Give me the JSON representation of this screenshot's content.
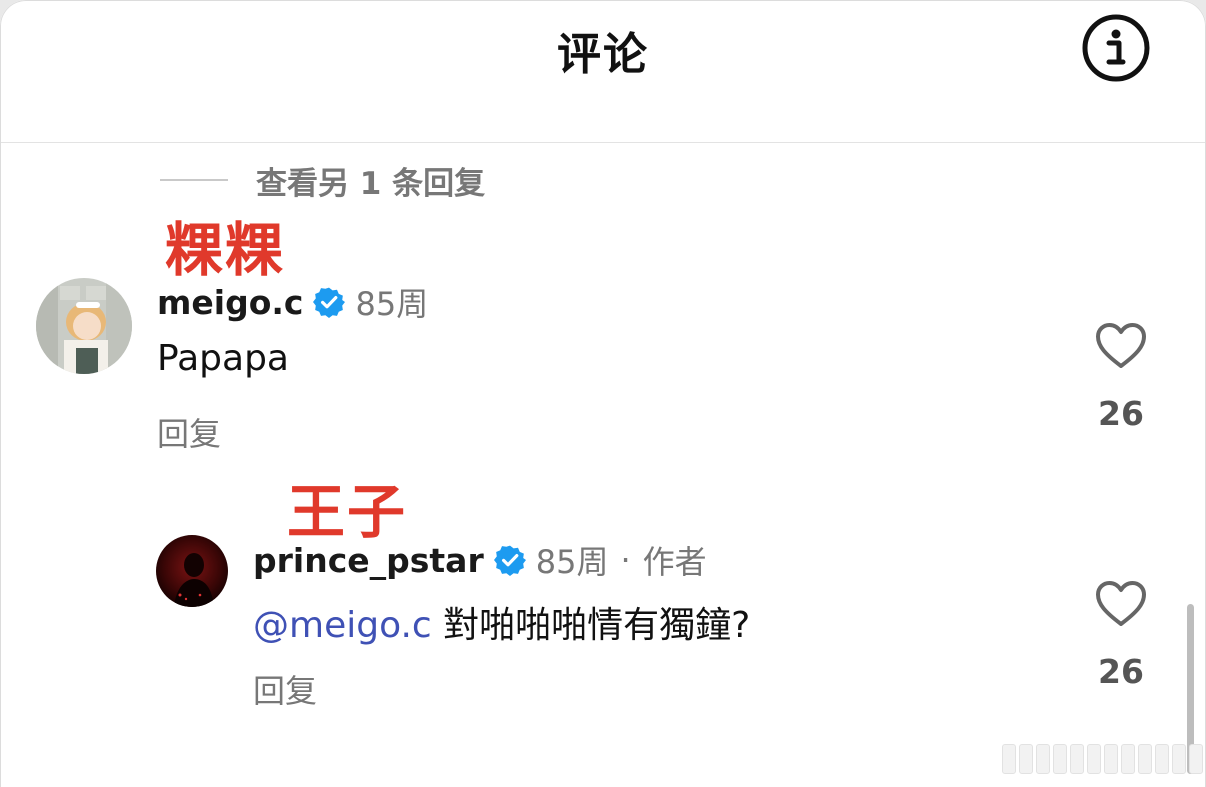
{
  "header": {
    "title": "评论",
    "info_icon": "info-circle-icon"
  },
  "thread": {
    "view_more_label": "查看另 1 条回复"
  },
  "annotations": [
    {
      "text": "粿粿",
      "color": "#e0392b"
    },
    {
      "text": "王子",
      "color": "#e0392b"
    }
  ],
  "comments": [
    {
      "username": "meigo.c",
      "verified": true,
      "time": "85周",
      "text": "Papapa",
      "reply_label": "回复",
      "likes": "26"
    },
    {
      "username": "prince_pstar",
      "verified": true,
      "time": "85周",
      "separator": "·",
      "author_tag": "作者",
      "mention": "@meigo.c",
      "text": " 對啪啪啪情有獨鐘?",
      "reply_label": "回复",
      "likes": "26"
    }
  ],
  "colors": {
    "verified_blue": "#1d9bf0",
    "mention_blue": "#3f51b5",
    "annotation_red": "#e0392b"
  }
}
